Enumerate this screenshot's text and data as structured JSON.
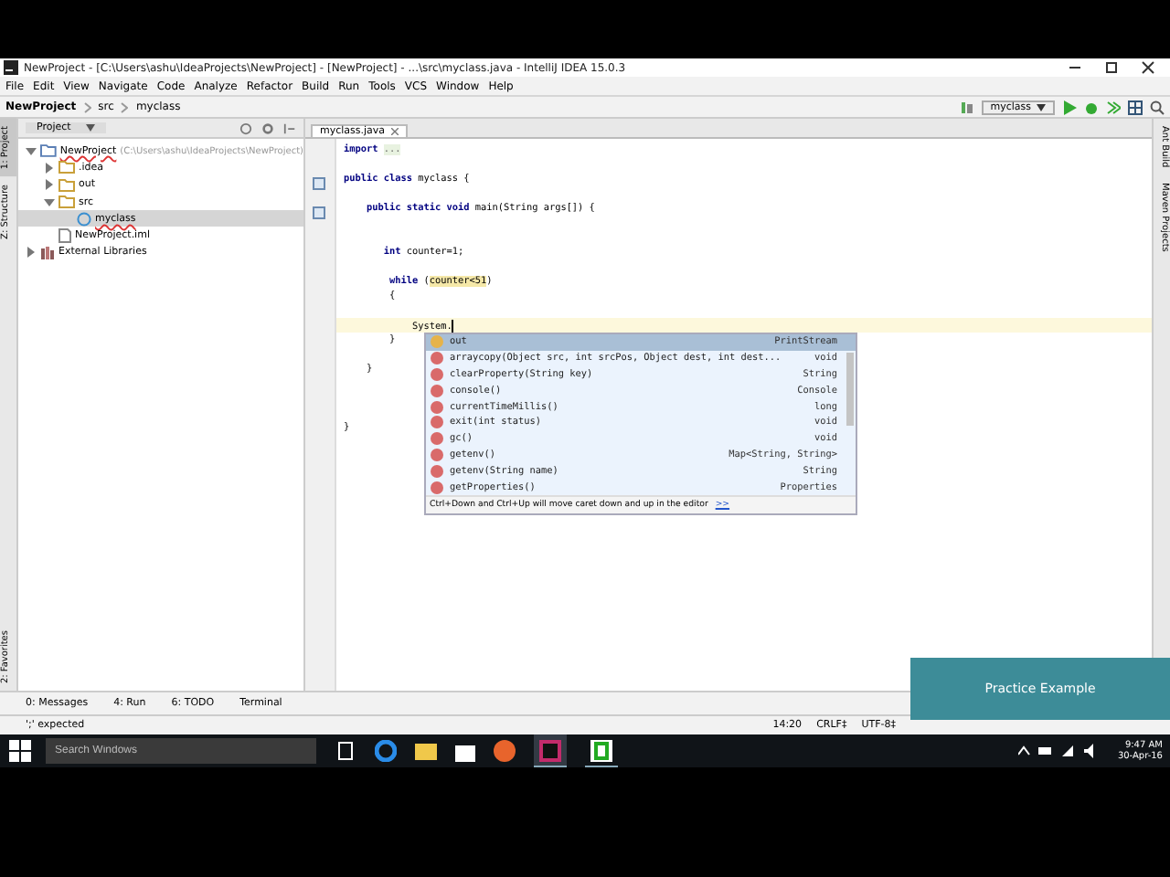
{
  "window": {
    "title": "NewProject - [C:\\Users\\ashu\\IdeaProjects\\NewProject] - [NewProject] - ...\\src\\myclass.java - IntelliJ IDEA 15.0.3"
  },
  "menu": [
    "File",
    "Edit",
    "View",
    "Navigate",
    "Code",
    "Analyze",
    "Refactor",
    "Build",
    "Run",
    "Tools",
    "VCS",
    "Window",
    "Help"
  ],
  "breadcrumb": [
    "NewProject",
    "src",
    "myclass"
  ],
  "run_config": "myclass",
  "left_strip": [
    {
      "label": "1: Project",
      "selected": true
    },
    {
      "label": "Z: Structure",
      "selected": false
    },
    {
      "label": "2: Favorites",
      "selected": false
    }
  ],
  "right_strip": [
    "Ant Build",
    "Maven Projects"
  ],
  "project_panel": {
    "title": "Project",
    "tree": [
      {
        "label": "NewProject",
        "hint": "(C:\\Users\\ashu\\IdeaProjects\\NewProject)",
        "kind": "module",
        "expanded": true,
        "selected": false,
        "children": [
          {
            "label": ".idea",
            "kind": "folder",
            "expanded": false,
            "selected": false
          },
          {
            "label": "out",
            "kind": "folder",
            "expanded": false,
            "selected": false
          },
          {
            "label": "src",
            "kind": "folder",
            "expanded": true,
            "selected": false,
            "children": [
              {
                "label": "myclass",
                "kind": "class",
                "selected": true
              }
            ]
          },
          {
            "label": "NewProject.iml",
            "kind": "file",
            "selected": false
          }
        ]
      },
      {
        "label": "External Libraries",
        "kind": "library",
        "expanded": false,
        "selected": false
      }
    ]
  },
  "editor": {
    "tab": "myclass.java",
    "lines": [
      {
        "current": false,
        "segments": [
          {
            "text": "import ",
            "kind": "keyword"
          },
          {
            "text": "...",
            "kind": "fold"
          }
        ]
      },
      {
        "current": false
      },
      {
        "current": false,
        "segments": [
          {
            "text": "public class ",
            "kind": "keyword"
          },
          {
            "text": "myclass {",
            "kind": "plain"
          }
        ]
      },
      {
        "current": false
      },
      {
        "current": false,
        "segments": [
          {
            "text": "    public static void ",
            "kind": "keyword"
          },
          {
            "text": "main(String args[]) {",
            "kind": "plain"
          }
        ]
      },
      {
        "current": false
      },
      {
        "current": false
      },
      {
        "current": false,
        "segments": [
          {
            "text": "       int ",
            "kind": "keyword"
          },
          {
            "text": "counter=1;",
            "kind": "plain"
          }
        ]
      },
      {
        "current": false
      },
      {
        "current": false,
        "segments": [
          {
            "text": "        while ",
            "kind": "keyword"
          },
          {
            "text": "(",
            "kind": "plain"
          },
          {
            "text": "counter<51",
            "kind": "match"
          },
          {
            "text": ")",
            "kind": "plain"
          }
        ]
      },
      {
        "current": false,
        "segments": [
          {
            "text": "        {",
            "kind": "plain"
          }
        ]
      },
      {
        "current": false
      },
      {
        "current": true,
        "segments": [
          {
            "text": "            System.",
            "kind": "plain"
          }
        ]
      },
      {
        "current": false,
        "segments": [
          {
            "text": "        }",
            "kind": "plain"
          }
        ]
      },
      {
        "current": false
      },
      {
        "current": false,
        "segments": [
          {
            "text": "    }",
            "kind": "plain"
          }
        ]
      },
      {
        "current": false
      },
      {
        "current": false
      },
      {
        "current": false
      },
      {
        "current": false,
        "segments": [
          {
            "text": "}",
            "kind": "plain"
          }
        ]
      }
    ]
  },
  "completion": {
    "items": [
      {
        "name": "out",
        "type": "PrintStream",
        "kind": "field",
        "selected": true
      },
      {
        "name": "arraycopy(Object src, int srcPos, Object dest, int dest...",
        "type": "void",
        "kind": "method",
        "selected": false
      },
      {
        "name": "clearProperty(String key)",
        "type": "String",
        "kind": "method",
        "selected": false
      },
      {
        "name": "console()",
        "type": "Console",
        "kind": "method",
        "selected": false
      },
      {
        "name": "currentTimeMillis()",
        "type": "long",
        "kind": "method",
        "selected": false
      },
      {
        "name": "exit(int status)",
        "type": "void",
        "kind": "method",
        "selected": false
      },
      {
        "name": "gc()",
        "type": "void",
        "kind": "method",
        "selected": false
      },
      {
        "name": "getenv()",
        "type": "Map<String, String>",
        "kind": "method",
        "selected": false
      },
      {
        "name": "getenv(String name)",
        "type": "String",
        "kind": "method",
        "selected": false
      },
      {
        "name": "getProperties()",
        "type": "Properties",
        "kind": "method",
        "selected": false
      }
    ],
    "hint": "Ctrl+Down and Ctrl+Up will move caret down and up in the editor",
    "hint_link": ">>"
  },
  "tool_tabs": [
    "0: Messages",
    "4: Run",
    "6: TODO",
    "Terminal"
  ],
  "status_bar": {
    "message": "';' expected",
    "position": "14:20",
    "line_sep": "CRLF‡",
    "encoding": "UTF-8‡"
  },
  "overlay": {
    "caption": "Practice Example"
  },
  "taskbar": {
    "search_placeholder": "Search Windows",
    "time": "9:47 AM",
    "date": "30-Apr-16"
  }
}
